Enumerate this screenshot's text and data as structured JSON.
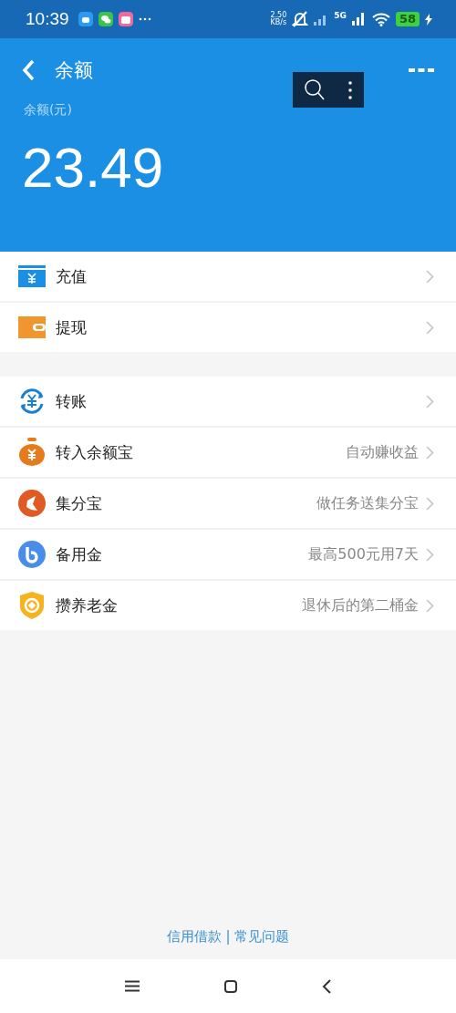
{
  "status_bar": {
    "time": "10:39",
    "speed": "2.50",
    "speed_unit": "KB/s",
    "network": "5G",
    "battery": "58"
  },
  "header": {
    "title": "余额",
    "balance_label": "余额(元)",
    "balance": "23.49"
  },
  "groups": [
    {
      "items": [
        {
          "label": "充值"
        },
        {
          "label": "提现"
        }
      ]
    },
    {
      "items": [
        {
          "label": "转账"
        },
        {
          "label": "转入余额宝",
          "hint": "自动赚收益"
        },
        {
          "label": "集分宝",
          "hint": "做任务送集分宝"
        },
        {
          "label": "备用金",
          "hint": "最高500元用7天"
        },
        {
          "label": "攒养老金",
          "hint": "退休后的第二桶金"
        }
      ]
    }
  ],
  "footer": {
    "links": [
      "信用借款",
      "常见问题"
    ],
    "separator": "|"
  }
}
